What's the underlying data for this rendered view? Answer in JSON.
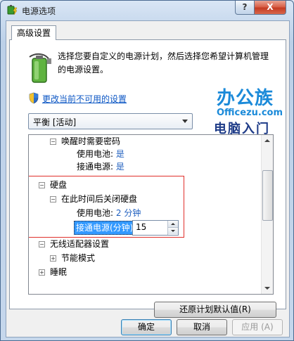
{
  "window": {
    "title": "电源选项",
    "help_label": "?",
    "close_label": "X"
  },
  "tabs": [
    {
      "label": "高级设置"
    }
  ],
  "description": "选择您要自定义的电源计划，然后选择您希望计算机管理的电源设置。",
  "change_settings_link": "更改当前不可用的设置",
  "watermark": {
    "line1": "办公族",
    "line2": "Officezu.com",
    "line3": "电脑入门"
  },
  "plan_select": {
    "value": "平衡 [活动]"
  },
  "tree": {
    "items": [
      {
        "label": "唤醒时需要密码",
        "expander": "−"
      },
      {
        "label": "使用电池:",
        "value": "是"
      },
      {
        "label": "接通电源:",
        "value": "是"
      },
      {
        "label": "硬盘",
        "expander": "−"
      },
      {
        "label": "在此时间后关闭硬盘",
        "expander": "−"
      },
      {
        "label": "使用电池:",
        "value": "2 分钟"
      },
      {
        "label": "接通电源(分钟):",
        "value": "15"
      },
      {
        "label": "无线适配器设置",
        "expander": "−"
      },
      {
        "label": "节能模式",
        "expander": "+"
      },
      {
        "label": "睡眠",
        "expander": "+"
      }
    ]
  },
  "restore_button": "还原计划默认值(R)",
  "buttons": {
    "ok": "确定",
    "cancel": "取消",
    "apply": "应用 (A)"
  },
  "colors": {
    "link": "#0b56c4",
    "value_text": "#1f5fbf",
    "highlight_box": "#e0302b",
    "selection": "#3399ff"
  }
}
